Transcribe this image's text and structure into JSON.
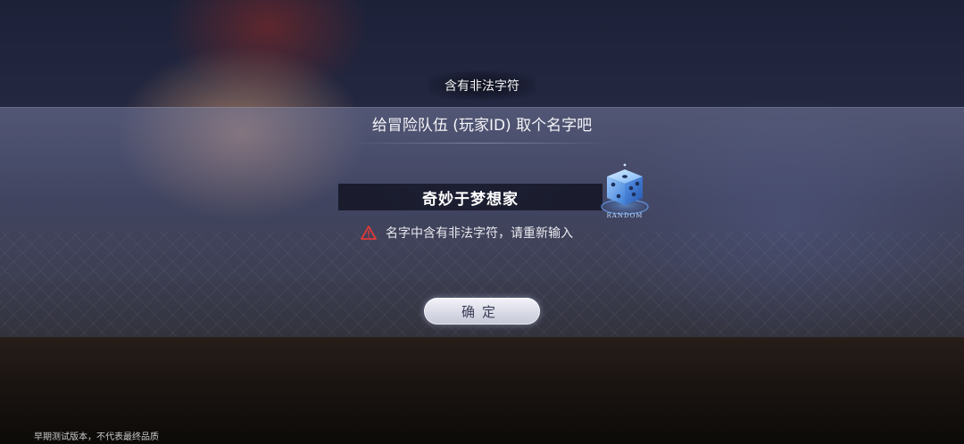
{
  "toast": {
    "text": "含有非法字符"
  },
  "dialog": {
    "title": "给冒险队伍 (玩家ID) 取个名字吧",
    "name_value": "奇妙于梦想家",
    "random_label": "RANDOM",
    "error_text": "名字中含有非法字符，请重新输入",
    "confirm_label": "确定"
  },
  "footer": {
    "note": "早期测试版本，不代表最终品质"
  },
  "icons": {
    "random": "dice-icon",
    "warning": "warning-triangle-icon"
  },
  "colors": {
    "warning": "#e03a3a",
    "dice": "#3f8cf0"
  }
}
